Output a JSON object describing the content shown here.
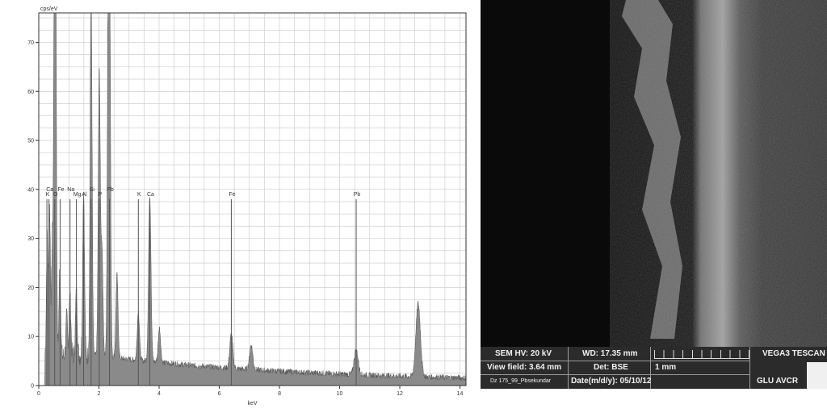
{
  "chart_data": {
    "type": "line",
    "title": "",
    "ylabel": "cps/eV",
    "xlabel": "keV",
    "xlim": [
      0,
      14.2
    ],
    "ylim": [
      0,
      76
    ],
    "grid": true,
    "xticks": [
      0,
      2,
      4,
      6,
      8,
      10,
      12,
      14
    ],
    "yticks": [
      0,
      10,
      20,
      30,
      40,
      50,
      60,
      70
    ],
    "peaks": [
      {
        "x": 0.28,
        "y": 25
      },
      {
        "x": 0.36,
        "y": 30
      },
      {
        "x": 0.45,
        "y": 22
      },
      {
        "x": 0.52,
        "y": 70
      },
      {
        "x": 0.56,
        "y": 76
      },
      {
        "x": 0.7,
        "y": 18
      },
      {
        "x": 0.93,
        "y": 8
      },
      {
        "x": 1.04,
        "y": 12
      },
      {
        "x": 1.25,
        "y": 13
      },
      {
        "x": 1.49,
        "y": 34
      },
      {
        "x": 1.74,
        "y": 76
      },
      {
        "x": 2.01,
        "y": 58
      },
      {
        "x": 2.1,
        "y": 22
      },
      {
        "x": 2.32,
        "y": 76
      },
      {
        "x": 2.35,
        "y": 60
      },
      {
        "x": 2.6,
        "y": 17
      },
      {
        "x": 3.31,
        "y": 10
      },
      {
        "x": 3.69,
        "y": 34
      },
      {
        "x": 4.01,
        "y": 7
      },
      {
        "x": 6.4,
        "y": 7
      },
      {
        "x": 7.06,
        "y": 5
      },
      {
        "x": 10.55,
        "y": 5
      },
      {
        "x": 12.61,
        "y": 15
      }
    ],
    "markers": [
      {
        "label": "K",
        "x": 0.27
      },
      {
        "label": "Ca",
        "x": 0.34
      },
      {
        "label": "O",
        "x": 0.53
      },
      {
        "label": "Fe",
        "x": 0.71
      },
      {
        "label": "Mg",
        "x": 1.25
      },
      {
        "label": "Na",
        "x": 1.04
      },
      {
        "label": "Al",
        "x": 1.49
      },
      {
        "label": "Si",
        "x": 1.74
      },
      {
        "label": "P",
        "x": 2.01
      },
      {
        "label": "Pb",
        "x": 2.35
      },
      {
        "label": "K",
        "x": 3.31
      },
      {
        "label": "Ca",
        "x": 3.69
      },
      {
        "label": "Fe",
        "x": 6.4
      },
      {
        "label": "Pb",
        "x": 10.55
      }
    ],
    "marker_height": 38,
    "colors": {
      "fill": "#8a8a8a",
      "line": "#555555",
      "grid": "#c8c8c8"
    }
  },
  "sem": {
    "hv": "SEM HV: 20 kV",
    "wd": "WD: 17.35 mm",
    "brand": "VEGA3 TESCAN",
    "view_field": "View field: 3.64 mm",
    "det": "Det: BSE",
    "scale_label": "1 mm",
    "sample": "Dz 175_99_Pbsekundar",
    "date": "Date(m/d/y): 05/10/12",
    "org": "GLU AVCR"
  }
}
